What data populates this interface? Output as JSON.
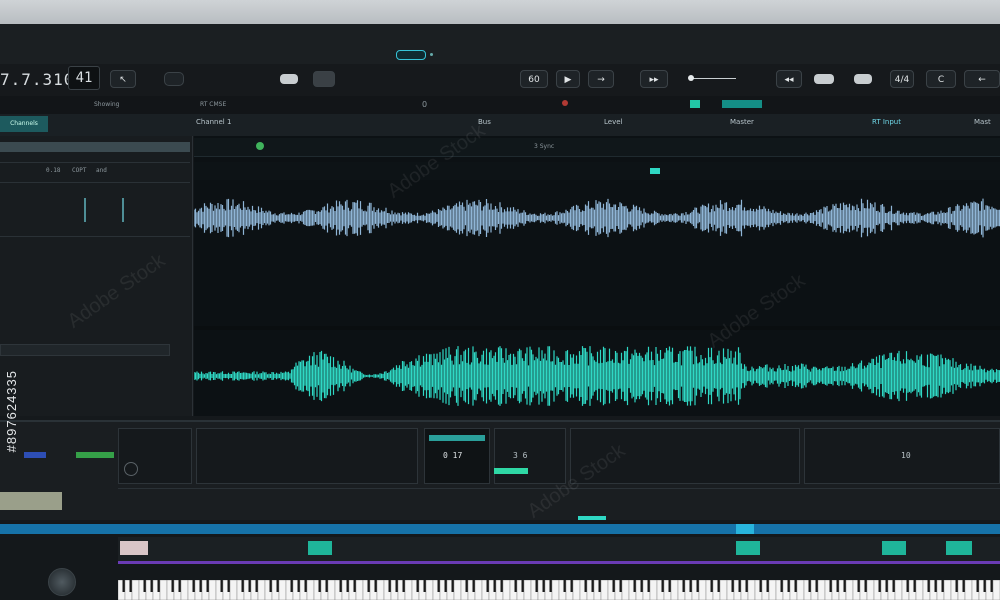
{
  "transport": {
    "time": "7.7.310",
    "bar": "41",
    "play": "▶",
    "tempo": "60",
    "sig": "4/4",
    "loop": "C"
  },
  "toolstrip": {
    "label_a": "Showing",
    "label_b": "RT CMSE",
    "zero": "0"
  },
  "header": {
    "left": "Channels",
    "ch1": "Channel 1",
    "ch2": "Bus",
    "ch3": "Level",
    "ch4": "Master",
    "ch5": "RT Input",
    "ch6": "Mast"
  },
  "left_panel": {
    "value_a": "0.18",
    "value_b": "COPT",
    "value_c": "and"
  },
  "editor": {
    "ruler_label": "3 Sync"
  },
  "mixer": {
    "display_a": "0 17",
    "display_b": "3 6",
    "display_c": "10"
  },
  "watermark": {
    "text": "Adobe Stock",
    "id": "#897624335"
  },
  "colors": {
    "accent_teal": "#3ad6c2",
    "waveform_top": "#8fb5d6",
    "waveform_bottom": "#2fd8c4",
    "band_blue": "#1672a8",
    "band_purple": "#6a3bb5"
  }
}
